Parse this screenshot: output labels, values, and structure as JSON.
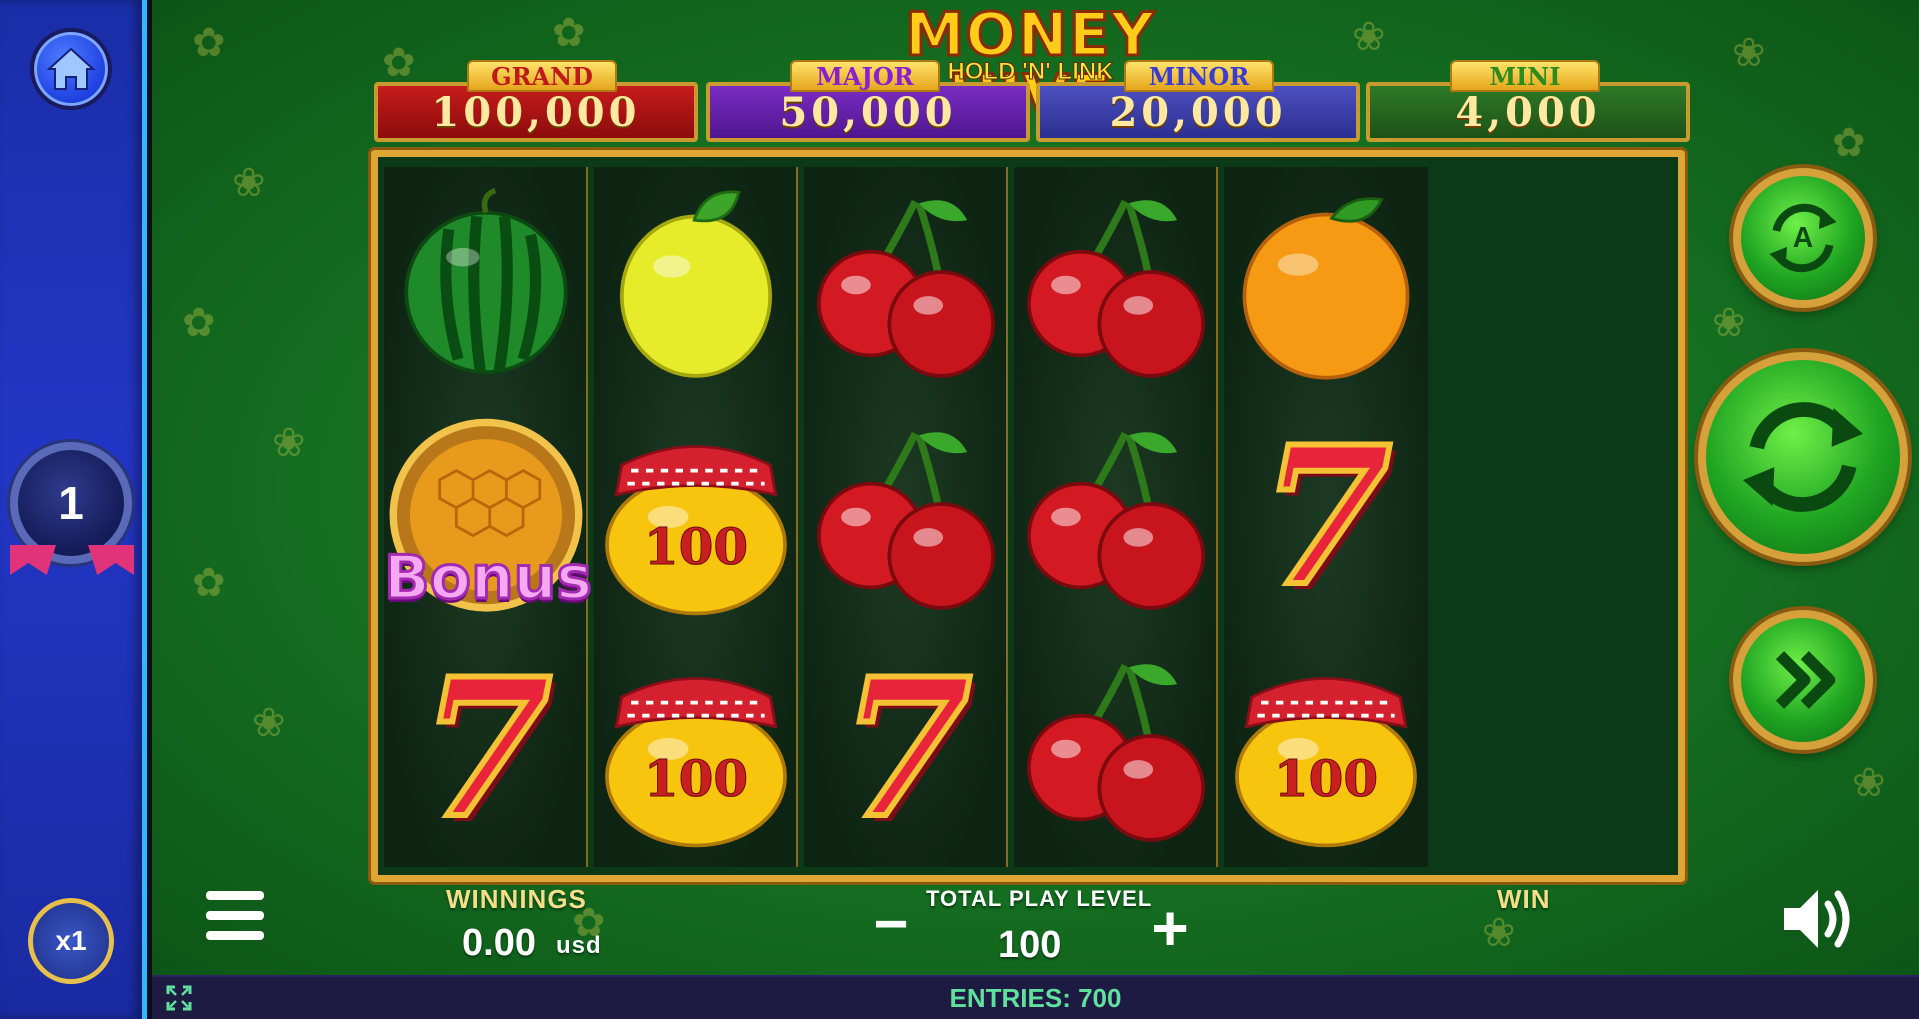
{
  "game": {
    "title": "MONEY HIVE",
    "subtitle": "HOLD 'N' LINK"
  },
  "jackpots": [
    {
      "label": "GRAND",
      "value": "100,000",
      "color": "#c71c1c"
    },
    {
      "label": "MAJOR",
      "value": "50,000",
      "color": "#7a2cc2"
    },
    {
      "label": "MINOR",
      "value": "20,000",
      "color": "#4d4fc0"
    },
    {
      "label": "MINI",
      "value": "4,000",
      "color": "#2e7a26"
    }
  ],
  "reels": [
    [
      "watermelon",
      "bonus",
      "seven"
    ],
    [
      "lemon",
      "honey-jar",
      "honey-jar"
    ],
    [
      "cherry",
      "cherry",
      "seven"
    ],
    [
      "cherry",
      "cherry",
      "cherry"
    ],
    [
      "orange",
      "seven",
      "honey-jar"
    ]
  ],
  "symbols": {
    "bonus_label": "Bonus",
    "honey_jar_value": "100",
    "seven_label": "7"
  },
  "sidebar": {
    "level": "1",
    "multiplier": "x1"
  },
  "bottom": {
    "winnings_label": "WINNINGS",
    "winnings_value": "0.00",
    "currency": "usd",
    "play_level_label": "TOTAL PLAY LEVEL",
    "play_level_value": "100",
    "minus": "−",
    "plus": "+",
    "win_label": "WIN",
    "entries": "ENTRIES: 700"
  },
  "buttons": {
    "autoplay_letter": "A"
  },
  "colors": {
    "accent_gold": "#e0a634",
    "sidebar_blue": "#2236c6",
    "bg_green": "#157021",
    "entries_green": "#5fe09c"
  }
}
